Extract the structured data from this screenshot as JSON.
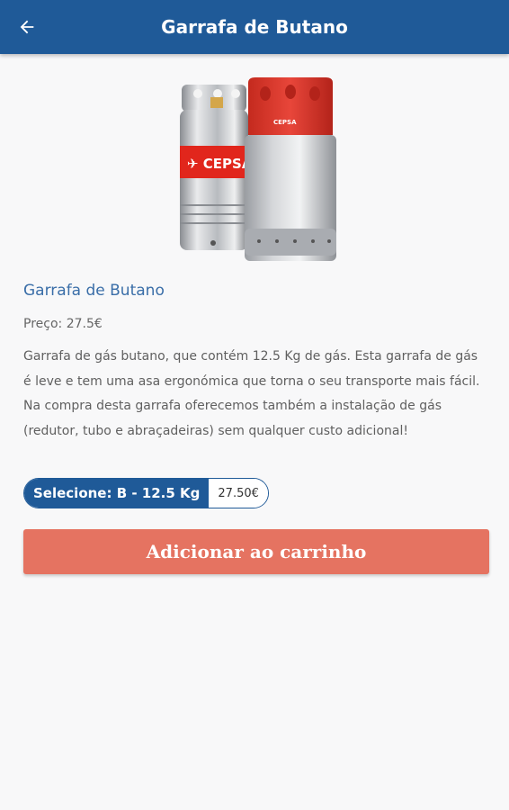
{
  "appbar": {
    "title": "Garrafa de Butano",
    "back_icon": "arrow-left-icon"
  },
  "product": {
    "name": "Garrafa de Butano",
    "price_line": "Preço: 27.5€",
    "description": "Garrafa de gás butano, que contém 12.5 Kg de gás. Esta garrafa de gás é leve e tem uma asa ergonómica que torna o seu transporte mais fácil. Na compra desta garrafa oferecemos também a instalação de gás (redutor,  tubo e abraçadeiras) sem qualquer custo adicional!",
    "image_brand": "CEPSA"
  },
  "option": {
    "label": "Selecione: B - 12.5 Kg",
    "price": "27.50€"
  },
  "actions": {
    "add_to_cart": "Adicionar ao carrinho"
  },
  "colors": {
    "appbar": "#1f5a98",
    "accent_button": "#e57361",
    "product_name": "#3a6ea8"
  }
}
